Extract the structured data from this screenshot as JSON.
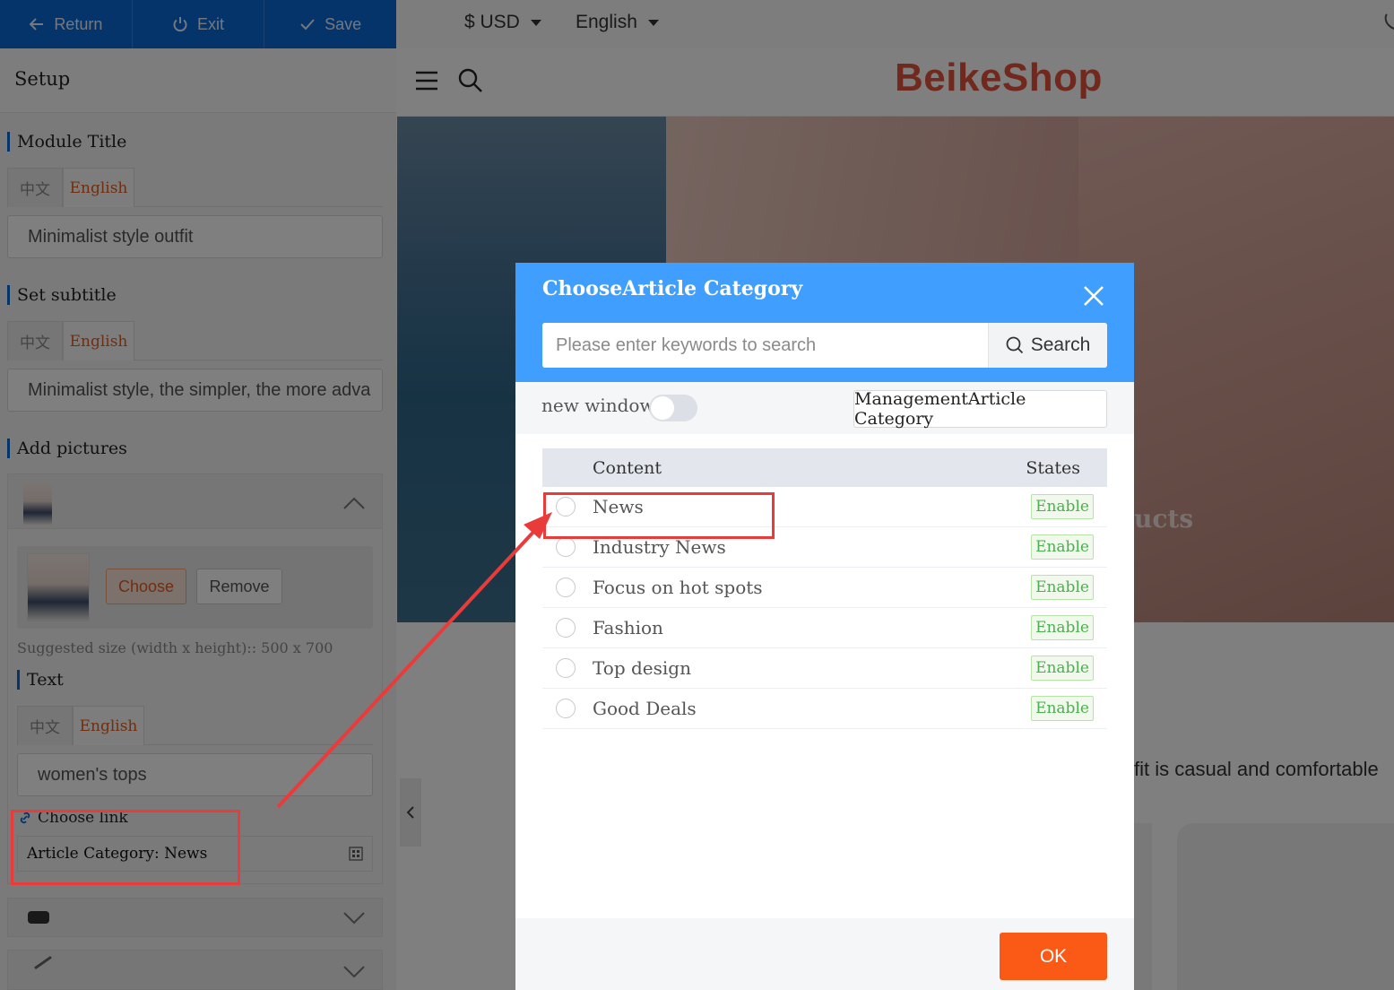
{
  "topbar": {
    "return_label": "Return",
    "exit_label": "Exit",
    "save_label": "Save"
  },
  "panel": {
    "setup_label": "Setup",
    "module_title": {
      "label": "Module Title",
      "tabs": [
        "中文",
        "English"
      ],
      "value": "Minimalist style outfit"
    },
    "subtitle": {
      "label": "Set subtitle",
      "tabs": [
        "中文",
        "English"
      ],
      "value": "Minimalist style, the simpler, the more adva"
    },
    "pictures": {
      "label": "Add pictures",
      "choose_label": "Choose",
      "remove_label": "Remove",
      "size_hint": "Suggested size (width x height):: 500 x 700",
      "text_label": "Text",
      "text_tabs": [
        "中文",
        "English"
      ],
      "text_value": "women's tops",
      "link_label": "Choose link",
      "link_value": "Article Category: News"
    }
  },
  "preview": {
    "currency": "$ USD",
    "language": "English",
    "logo": "BeikeShop",
    "hero_text_fragment": "ucts",
    "body_text_fragment": "fit is casual and comfortable"
  },
  "modal": {
    "title": "ChooseArticle Category",
    "search_placeholder": "Please enter keywords to search",
    "search_button": "Search",
    "new_window_label": "new window:",
    "new_window_on": false,
    "management_button": "ManagementArticle Category",
    "columns": {
      "content": "Content",
      "states": "States"
    },
    "rows": [
      {
        "name": "News",
        "state": "Enable"
      },
      {
        "name": "Industry News",
        "state": "Enable"
      },
      {
        "name": "Focus on hot spots",
        "state": "Enable"
      },
      {
        "name": "Fashion",
        "state": "Enable"
      },
      {
        "name": "Top design",
        "state": "Enable"
      },
      {
        "name": "Good Deals",
        "state": "Enable"
      }
    ],
    "ok_button": "OK"
  },
  "colors": {
    "primary_blue": "#0b68d4",
    "modal_header": "#409efe",
    "accent_orange": "#fb5a16",
    "annotation_red": "#ea3b3b",
    "enable_green": "#4caf50"
  }
}
